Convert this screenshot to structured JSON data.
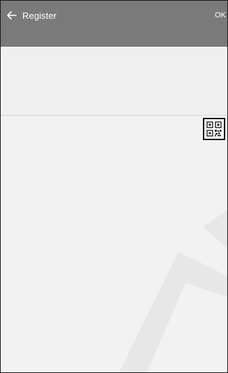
{
  "header": {
    "back_label": "Register",
    "ok_label": "OK",
    "back_icon": "arrow-left-icon"
  },
  "toolbar": {
    "qr_icon": "qr-code-scan-icon"
  },
  "colors": {
    "app_bar": "#7a7a7a",
    "background": "#f2f2f2",
    "watermark": "#e6e6e6"
  }
}
